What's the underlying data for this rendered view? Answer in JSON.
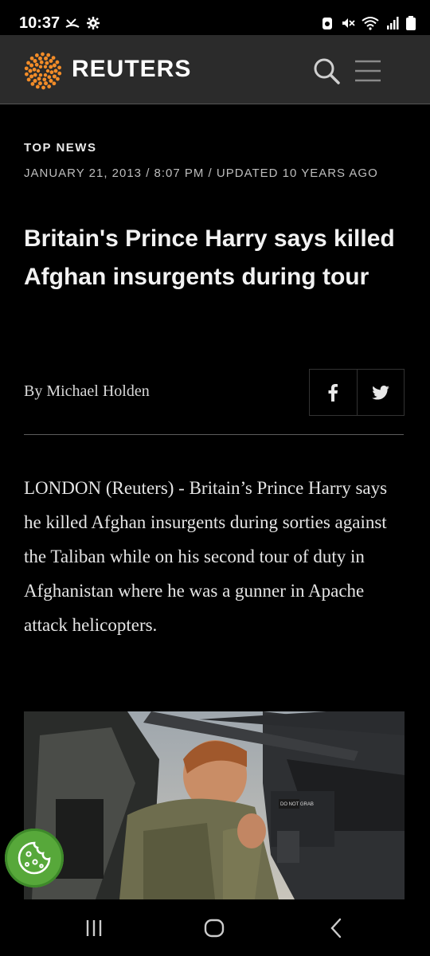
{
  "status_bar": {
    "time": "10:37"
  },
  "header": {
    "brand": "REUTERS"
  },
  "article": {
    "section": "TOP NEWS",
    "dateline": "JANUARY 21, 2013 / 8:07 PM / UPDATED 10 YEARS AGO",
    "headline": "Britain's Prince Harry says killed Afghan insurgents during tour",
    "byline": "By Michael Holden",
    "body": "LONDON (Reuters) - Britain’s Prince Harry says he killed Afghan insurgents during sorties against the Taliban while on his second tour of duty in Afghanistan where he was a gunner in Apache attack helicopters.",
    "photo_sign_text": "DO NOT GRAB"
  },
  "icons": {
    "status_left": [
      "missed-call-icon",
      "gear-icon"
    ],
    "status_right": [
      "alarm-icon",
      "mute-icon",
      "wifi-icon",
      "signal-icon",
      "battery-icon"
    ],
    "header": [
      "reuters-logo",
      "search-icon",
      "menu-icon"
    ],
    "share": [
      "facebook-icon",
      "twitter-icon"
    ],
    "nav": [
      "recent-apps-icon",
      "home-icon",
      "back-icon"
    ],
    "floating": [
      "cookie-icon"
    ]
  },
  "colors": {
    "background": "#000000",
    "header": "#2b2b2b",
    "logo_orange": "#f28c28",
    "cookie_green": "#57a83a"
  }
}
